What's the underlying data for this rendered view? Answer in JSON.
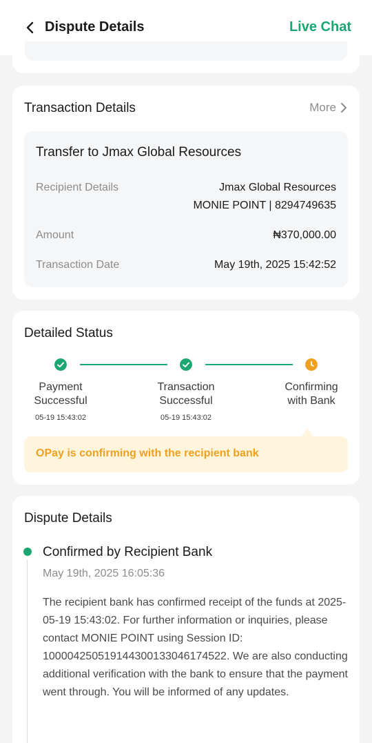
{
  "header": {
    "title": "Dispute Details",
    "live_chat": "Live Chat"
  },
  "transaction": {
    "title": "Transaction Details",
    "more": "More",
    "inner_title": "Transfer to Jmax Global Resources",
    "recipient_label": "Recipient Details",
    "recipient_name": "Jmax Global Resources",
    "recipient_bank": "MONIE POINT | 8294749635",
    "amount_label": "Amount",
    "amount": "₦370,000.00",
    "date_label": "Transaction Date",
    "date": "May 19th, 2025 15:42:52"
  },
  "status": {
    "title": "Detailed Status",
    "steps": [
      {
        "line1": "Payment",
        "line2": "Successful",
        "time": "05-19 15:43:02",
        "state": "done"
      },
      {
        "line1": "Transaction",
        "line2": "Successful",
        "time": "05-19 15:43:02",
        "state": "done"
      },
      {
        "line1": "Confirming",
        "line2": "with Bank",
        "time": "",
        "state": "pending"
      }
    ],
    "notice": "OPay is confirming with the recipient bank"
  },
  "dispute": {
    "title": "Dispute Details",
    "event_title": "Confirmed by Recipient Bank",
    "event_time": "May 19th, 2025 16:05:36",
    "event_desc": "The recipient bank has confirmed receipt of the funds at 2025-05-19 15:43:02. For further information or inquiries, please contact MONIE POINT using Session ID: 100004250519144300133046174522. We are also conducting additional verification with the bank to ensure that the payment went through. You will be informed of any updates."
  },
  "colors": {
    "accent": "#1ba672",
    "pending": "#f0a020",
    "notice_bg": "#fff5dc"
  }
}
